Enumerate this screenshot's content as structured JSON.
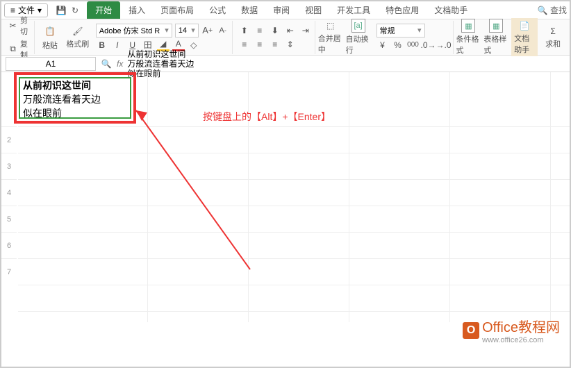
{
  "menu": {
    "file": "文件",
    "tabs": [
      "开始",
      "插入",
      "页面布局",
      "公式",
      "数据",
      "审阅",
      "视图",
      "开发工具",
      "特色应用",
      "文档助手"
    ],
    "find": "查找"
  },
  "ribbon": {
    "cut": "剪切",
    "copy": "复制",
    "paste": "粘贴",
    "fmtpaint": "格式刷",
    "font_name": "Adobe 仿宋 Std R",
    "font_size": "14",
    "merge": "合并居中",
    "autowrap": "自动换行",
    "numfmt": "常规",
    "condfmt": "条件格式",
    "tablefmt": "表格样式",
    "signsym": "%",
    "dochelper": "文档助手",
    "sum": "求和"
  },
  "cellref": {
    "name": "A1"
  },
  "formula_text": "从前初识这世间\n万般流连看着天边\n似在眼前",
  "cell_content": {
    "l1": "从前初识这世间",
    "l2": "万般流连看着天边",
    "l3": "似在眼前"
  },
  "annotation": "按键盘上的【Alt】+【Enter】",
  "rows": [
    "2",
    "3",
    "4",
    "5",
    "6",
    "7"
  ],
  "watermark": {
    "brand": "Office教程网",
    "url": "www.office26.com",
    "logo": "O"
  },
  "icons": {
    "menu": "≡",
    "dropdown": "▾",
    "search": "Q",
    "fx": "fx",
    "bold": "B",
    "italic": "I",
    "under": "U",
    "border": "田",
    "fill": "A",
    "fontc": "A",
    "alignL": "≡",
    "alignC": "≡",
    "alignR": "≡",
    "indentD": "◁",
    "indentI": "▷",
    "sizeUp": "A",
    "sizeDn": "A"
  }
}
